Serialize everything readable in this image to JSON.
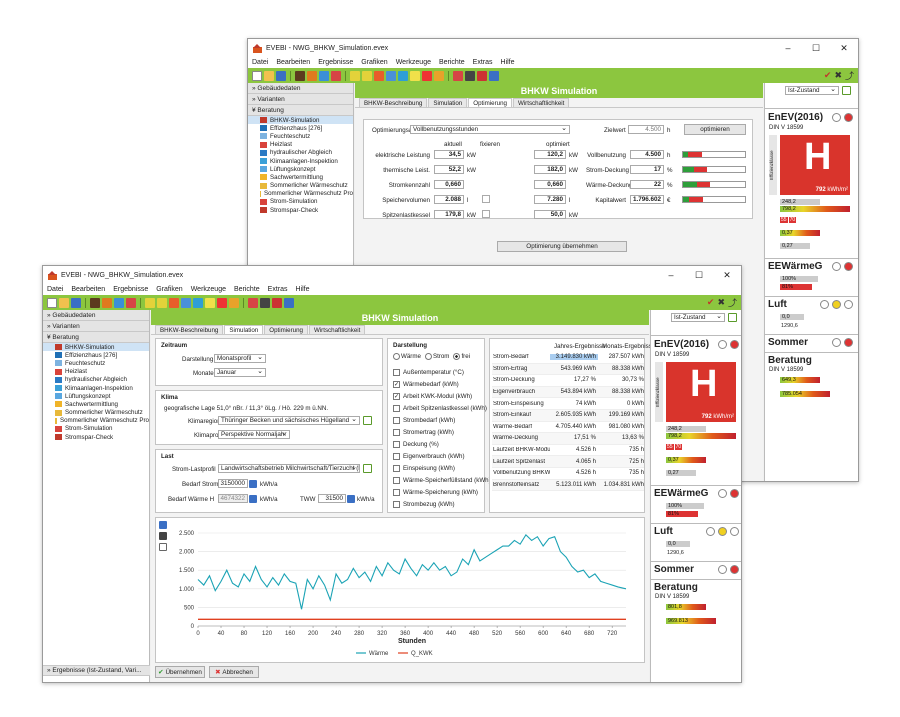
{
  "back": {
    "title": "EVEBI - NWG_BHKW_Simulation.evex",
    "menus": [
      "Datei",
      "Bearbeiten",
      "Ergebnisse",
      "Grafiken",
      "Werkzeuge",
      "Berichte",
      "Extras",
      "Hilfe"
    ],
    "nav_headers": [
      "Gebäudedaten",
      "Varianten",
      "Beratung"
    ],
    "nav_items": [
      "BHKW-Simulation",
      "Effizienzhaus [276]",
      "Feuchteschutz",
      "Heizlast",
      "hydraulischer Abgleich",
      "Klimaanlagen-Inspektion",
      "Lüftungskonzept",
      "Sachwertermittlung",
      "Sommerlicher Wärmeschutz",
      "Sommerlicher Wärmeschutz Pro",
      "Strom-Simulation",
      "Stromspar-Check"
    ],
    "panel_title": "BHKW Simulation",
    "tabs": [
      "BHKW-Beschreibung",
      "Simulation",
      "Optimierung",
      "Wirtschaftlichkeit"
    ],
    "opt": {
      "optimierungsart_label": "Optimierungsart",
      "optimierungsart_value": "Vollbenutzungsstunden",
      "zielwert_label": "Zielwert",
      "zielwert_value": "4.500",
      "zielwert_unit": "h",
      "optimieren_btn": "optimieren",
      "col_aktuell": "aktuell",
      "col_fixieren": "fixieren",
      "col_optimiert": "optimiert",
      "rows": [
        {
          "label": "elektrische Leistung",
          "aktuell": "34,5",
          "opt": "120,2",
          "unit": "kW"
        },
        {
          "label": "thermische Leist.",
          "aktuell": "52,2",
          "opt": "182,0",
          "unit": "kW"
        },
        {
          "label": "Stromkennzahl",
          "aktuell": "0,660",
          "opt": "0,660",
          "unit": ""
        },
        {
          "label": "Speichervolumen",
          "aktuell": "2.088",
          "opt": "7.280",
          "unit": "l"
        },
        {
          "label": "Spitzenlastkessel",
          "aktuell": "179,8",
          "opt": "50,0",
          "unit": "kW"
        }
      ],
      "results": [
        {
          "label": "Vollbenutzung",
          "value": "4.500",
          "unit": "h",
          "fill": 0.08
        },
        {
          "label": "Strom-Deckung",
          "value": "17",
          "unit": "%",
          "fill": 0.17
        },
        {
          "label": "Wärme-Deckung",
          "value": "22",
          "unit": "%",
          "fill": 0.22
        },
        {
          "label": "Kapitalwert",
          "value": "1.796.602",
          "unit": "€",
          "fill": 0.1
        }
      ],
      "apply_btn": "Optimierung übernehmen"
    },
    "right": {
      "zustand": "Ist-Zustand",
      "enev": "EnEV(2016)",
      "din": "DIN V 18599",
      "class_letter": "H",
      "ee_label": "Effizienzklasse",
      "kwh": "792",
      "kwh_unit": "kWh/m²",
      "qp1": "248,2",
      "qp2": "798,2",
      "s55": "55",
      "s70": "70",
      "ht": "0,37",
      "ht2": "0,27",
      "eew": "EEWärmeG",
      "eew1": "100%",
      "eew2": "81%",
      "luft": "Luft",
      "luft1": "0,0",
      "luft2": "1290,6",
      "sommer": "Sommer",
      "beratung": "Beratung",
      "b1": "649,3",
      "b2": "785.054"
    }
  },
  "front": {
    "title": "EVEBI - NWG_BHKW_Simulation.evex",
    "menus": [
      "Datei",
      "Bearbeiten",
      "Ergebnisse",
      "Grafiken",
      "Werkzeuge",
      "Berichte",
      "Extras",
      "Hilfe"
    ],
    "nav_headers": [
      "Gebäudedaten",
      "Varianten",
      "Beratung"
    ],
    "nav_items": [
      "BHKW-Simulation",
      "Effizienzhaus [276]",
      "Feuchteschutz",
      "Heizlast",
      "hydraulischer Abgleich",
      "Klimaanlagen-Inspektion",
      "Lüftungskonzept",
      "Sachwertermittlung",
      "Sommerlicher Wärmeschutz",
      "Sommerlicher Wärmeschutz Pro",
      "Strom-Simulation",
      "Stromspar-Check"
    ],
    "nav_bottom": "Ergebnisse (Ist-Zustand, Vari...",
    "panel_title": "BHKW Simulation",
    "tabs": [
      "BHKW-Beschreibung",
      "Simulation",
      "Optimierung",
      "Wirtschaftlichkeit"
    ],
    "zeitraum": {
      "head": "Zeitraum",
      "darstellung_label": "Darstellung",
      "darstellung_value": "Monatsprofil",
      "monate_label": "Monate",
      "monate_value": "Januar"
    },
    "klima": {
      "head": "Klima",
      "lage": "geografische Lage  51,0° nBr. / 11,3° öLg. / Hö. 229 m ü.NN.",
      "region_label": "Klimaregion",
      "region_value": "Thüringer Becken und sächsisches Hügelland",
      "profil_label": "Klimaprofil",
      "profil_value": "Perspektive Normaljahr"
    },
    "last": {
      "head": "Last",
      "strom_profil_label": "Strom-Lastprofil",
      "strom_profil_value": "Landwirtschaftsbetrieb Milchwirtschaft/Tierzucht (M",
      "bedarf_strom_label": "Bedarf Strom",
      "bedarf_strom_value": "3150000",
      "bedarf_strom_unit": "kWh/a",
      "bedarf_waerme_label": "Bedarf Wärme H",
      "bedarf_waerme_value": "4674322",
      "bedarf_waerme_unit": "kWh/a",
      "tww_label": "TWW",
      "tww_value": "31500",
      "tww_unit": "kWh/a"
    },
    "darstellung": {
      "head": "Darstellung",
      "radios": [
        "Wärme",
        "Strom",
        "frei"
      ],
      "checks": [
        {
          "label": "Außentemperatur (°C)",
          "checked": false
        },
        {
          "label": "Wärmebedarf (kWh)",
          "checked": true
        },
        {
          "label": "Arbeit KWK-Modul (kWh)",
          "checked": true
        },
        {
          "label": "Arbeit Spitzenlastkessel (kWh)",
          "checked": false
        },
        {
          "label": "Strombedarf (kWh)",
          "checked": false
        },
        {
          "label": "Stromertrag (kWh)",
          "checked": false
        },
        {
          "label": "Deckung (%)",
          "checked": false
        },
        {
          "label": "Eigenverbrauch (kWh)",
          "checked": false
        },
        {
          "label": "Einspeisung (kWh)",
          "checked": false
        },
        {
          "label": "Wärme-Speicherfüllstand (kWh)",
          "checked": false
        },
        {
          "label": "Wärme-Speicherung (kWh)",
          "checked": false
        },
        {
          "label": "Strombezug (kWh)",
          "checked": false
        }
      ]
    },
    "results": {
      "col1": "Jahres-Ergebnisse",
      "col2": "Monats-Ergebnisse",
      "rows": [
        [
          "Strom-Bedarf",
          "3.149.830 kWh",
          "287.507 kWh"
        ],
        [
          "Strom-Ertrag",
          "543.969 kWh",
          "88.338 kWh"
        ],
        [
          "Strom-Deckung",
          "17,27 %",
          "30,73 %"
        ],
        [
          "Eigenverbrauch",
          "543.894 kWh",
          "88.338 kWh"
        ],
        [
          "Strom-Einspeisung",
          "74 kWh",
          "0 kWh"
        ],
        [
          "Strom-Einkauf",
          "2.605.935 kWh",
          "199.169 kWh"
        ],
        [
          "Wärme-Bedarf",
          "4.705.440 kWh",
          "981.080 kWh"
        ],
        [
          "Wärme-Deckung",
          "17,51 %",
          "13,63 %"
        ],
        [
          "Laufzeit BHKW-Modul",
          "4.526 h",
          "735 h"
        ],
        [
          "Laufzeit Spitzenlast",
          "4.065 h",
          "725 h"
        ],
        [
          "Vollbenutzung BHKW",
          "4.526 h",
          "735 h"
        ],
        [
          "Brennstoffeinsatz",
          "5.123.011 kWh",
          "1.034.831 kWh"
        ]
      ]
    },
    "buttons": {
      "ok": "Übernehmen",
      "cancel": "Abbrechen"
    },
    "right": {
      "zustand": "Ist-Zustand",
      "enev": "EnEV(2016)",
      "din": "DIN V 18599",
      "class_letter": "H",
      "ee_label": "Effizienzklasse",
      "kwh": "792",
      "kwh_unit": "kWh/m²",
      "qp1": "248,2",
      "qp2": "798,2",
      "s55": "55",
      "s70": "70",
      "ht": "0,37",
      "ht2": "0,27",
      "eew": "EEWärmeG",
      "eew1": "100%",
      "eew2": "81%",
      "luft": "Luft",
      "luft1": "0,0",
      "luft2": "1290,6",
      "sommer": "Sommer",
      "beratung": "Beratung",
      "b1": "801,8",
      "b2": "969.813"
    }
  },
  "chart_data": {
    "type": "line",
    "xlabel": "Stunden",
    "ylabel": "",
    "xlim": [
      0,
      744
    ],
    "ylim": [
      0,
      2500
    ],
    "xticks": [
      0,
      40,
      80,
      120,
      160,
      200,
      240,
      280,
      320,
      360,
      400,
      440,
      480,
      520,
      560,
      600,
      640,
      680,
      720
    ],
    "yticks": [
      "2.500",
      "2.000",
      "1.500",
      "1.000",
      "500",
      "0"
    ],
    "series": [
      {
        "name": "Wärme",
        "color": "#1ba3b5",
        "x": [
          0,
          10,
          20,
          30,
          40,
          50,
          60,
          70,
          80,
          90,
          100,
          110,
          120,
          130,
          140,
          150,
          160,
          170,
          180,
          190,
          200,
          210,
          220,
          230,
          240,
          250,
          260,
          270,
          280,
          290,
          300,
          310,
          320,
          330,
          340,
          350,
          360,
          370,
          380,
          390,
          400,
          410,
          420,
          430,
          440,
          450,
          460,
          470,
          480,
          490,
          500,
          510,
          520,
          530,
          540,
          550,
          560,
          570,
          580,
          590,
          600,
          610,
          620,
          630,
          640,
          650,
          660,
          670,
          680,
          690,
          700,
          710,
          720,
          730,
          744
        ],
        "y": [
          1250,
          1100,
          1350,
          950,
          1200,
          1500,
          1150,
          1050,
          1400,
          1200,
          1600,
          1250,
          1050,
          1300,
          1100,
          1400,
          1200,
          1150,
          450,
          1250,
          1000,
          1350,
          1100,
          700,
          1400,
          1150,
          1250,
          1550,
          1300,
          1450,
          1200,
          1600,
          1350,
          1700,
          1500,
          1400,
          1800,
          1550,
          1350,
          1650,
          1500,
          1700,
          1500,
          1600,
          1350,
          1450,
          1800,
          1650,
          2050,
          1750,
          1850,
          1950,
          2050,
          2150,
          2150,
          2300,
          2200,
          2450,
          2300,
          2400,
          2150,
          2350,
          2400,
          2000,
          1850,
          1600,
          1450,
          1500,
          1300,
          1400,
          1200,
          1150,
          1100,
          1050,
          1000
        ]
      },
      {
        "name": "Q_KWK",
        "color": "#e04020",
        "x": [
          0,
          744
        ],
        "y": [
          180,
          180
        ]
      }
    ]
  }
}
